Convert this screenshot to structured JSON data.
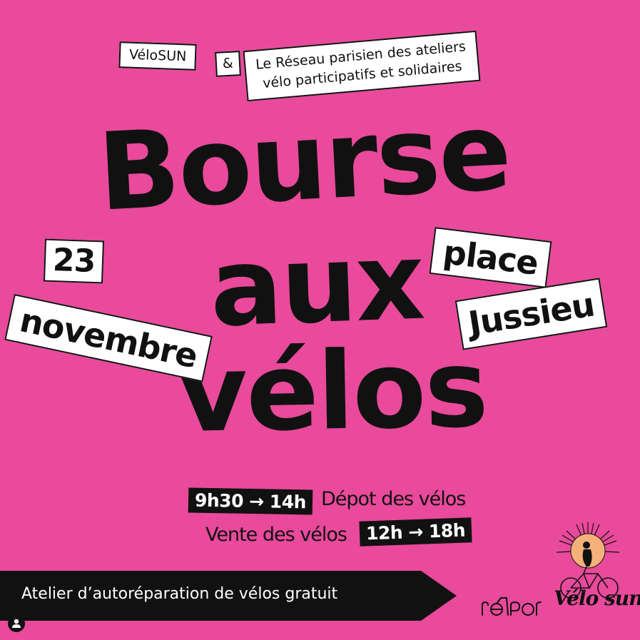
{
  "header": {
    "org1": "VéloSUN",
    "amp": "&",
    "org2_line1": "Le Réseau parisien des ateliers",
    "org2_line2": "vélo participatifs et solidaires"
  },
  "title": {
    "line1": "Bourse",
    "line2": "aux",
    "line3": "vélos"
  },
  "date": {
    "day": "23",
    "month": "novembre"
  },
  "place": {
    "line1": "place",
    "line2": "Jussieu"
  },
  "schedule": {
    "deposit_time": "9h30 → 14h",
    "deposit_label": "Dépot des vélos",
    "sale_label": "Vente des vélos",
    "sale_time": "12h → 18h"
  },
  "banner": {
    "text": "Atelier d’autoréparation de vélos gratuit"
  },
  "logos": {
    "reseau_icon": "reseau-bike-logo",
    "velosun_icon": "velosun-sun-bike-logo",
    "velosun_text": "Vélo sun"
  },
  "colors": {
    "background": "#e94a9b",
    "ink": "#111111",
    "paper": "#ffffff",
    "sun": "#f4b27a"
  }
}
